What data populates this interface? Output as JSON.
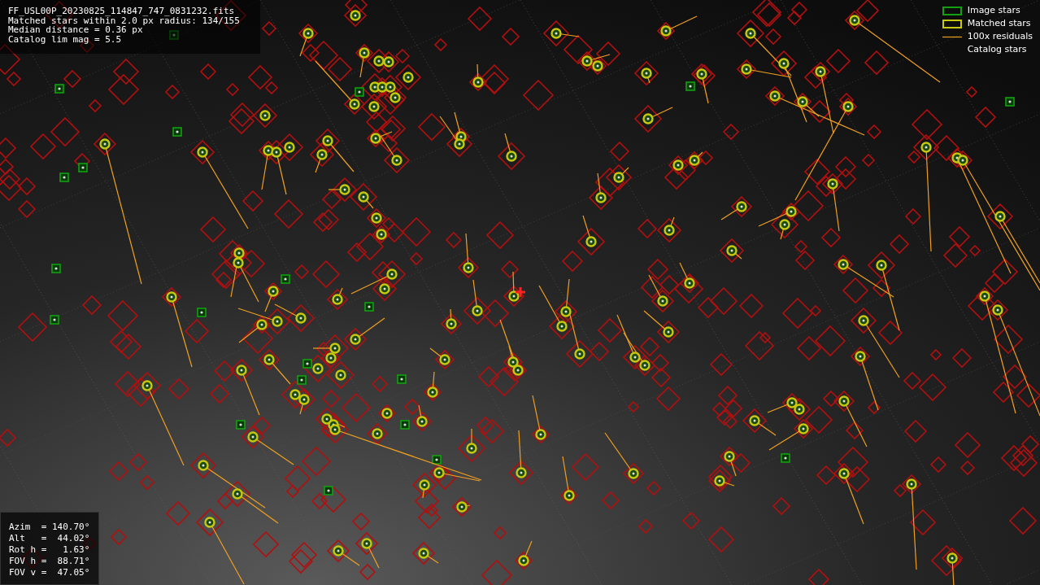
{
  "header": {
    "lines": [
      "FF_USL00P_20230825_114847_747_0831232.fits",
      "Matched stars within 2.0 px radius: 134/155",
      "Median distance = 0.36 px",
      "Catalog lim mag = 5.5"
    ]
  },
  "legend": [
    {
      "kind": "image",
      "label": "Image stars"
    },
    {
      "kind": "matched",
      "label": "Matched stars"
    },
    {
      "kind": "residual",
      "label": "100x residuals"
    },
    {
      "kind": "catalog",
      "label": "Catalog stars"
    }
  ],
  "pointing": {
    "lines": [
      "Azim  = 140.70°",
      "Alt   =  44.02°",
      "Rot h =   1.63°",
      "FOV h =  88.71°",
      "FOV v =  47.05°"
    ]
  }
}
